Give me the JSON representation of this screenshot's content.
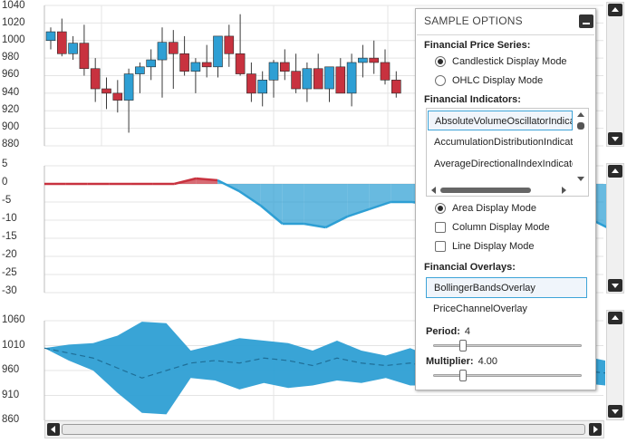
{
  "charts": {
    "price_axis": [
      "1040",
      "1020",
      "1000",
      "980",
      "960",
      "940",
      "920",
      "900",
      "880"
    ],
    "indicator_axis": [
      "5",
      "0",
      "-5",
      "-10",
      "-15",
      "-20",
      "-25",
      "-30"
    ],
    "overlay_axis": [
      "1060",
      "1010",
      "960",
      "910",
      "860"
    ]
  },
  "chart_data": [
    {
      "type": "candlestick",
      "ylim": [
        880,
        1040
      ],
      "rising_color": "#2e9fd4",
      "falling_color": "#c8323f",
      "candles": [
        {
          "o": 1000,
          "h": 1015,
          "l": 990,
          "c": 1010
        },
        {
          "o": 1010,
          "h": 1025,
          "l": 982,
          "c": 985
        },
        {
          "o": 985,
          "h": 1005,
          "l": 978,
          "c": 997
        },
        {
          "o": 997,
          "h": 1018,
          "l": 960,
          "c": 968
        },
        {
          "o": 968,
          "h": 980,
          "l": 930,
          "c": 945
        },
        {
          "o": 945,
          "h": 958,
          "l": 922,
          "c": 940
        },
        {
          "o": 940,
          "h": 955,
          "l": 918,
          "c": 932
        },
        {
          "o": 932,
          "h": 968,
          "l": 895,
          "c": 962
        },
        {
          "o": 962,
          "h": 975,
          "l": 940,
          "c": 970
        },
        {
          "o": 970,
          "h": 990,
          "l": 955,
          "c": 978
        },
        {
          "o": 978,
          "h": 1015,
          "l": 935,
          "c": 998
        },
        {
          "o": 998,
          "h": 1012,
          "l": 945,
          "c": 985
        },
        {
          "o": 985,
          "h": 1005,
          "l": 960,
          "c": 965
        },
        {
          "o": 965,
          "h": 980,
          "l": 940,
          "c": 975
        },
        {
          "o": 975,
          "h": 995,
          "l": 958,
          "c": 970
        },
        {
          "o": 970,
          "h": 985,
          "l": 958,
          "c": 1005
        },
        {
          "o": 1005,
          "h": 1018,
          "l": 970,
          "c": 985
        },
        {
          "o": 985,
          "h": 1030,
          "l": 960,
          "c": 962
        },
        {
          "o": 962,
          "h": 975,
          "l": 930,
          "c": 940
        },
        {
          "o": 940,
          "h": 965,
          "l": 925,
          "c": 955
        },
        {
          "o": 955,
          "h": 978,
          "l": 935,
          "c": 975
        },
        {
          "o": 975,
          "h": 990,
          "l": 955,
          "c": 965
        },
        {
          "o": 965,
          "h": 985,
          "l": 940,
          "c": 945
        },
        {
          "o": 945,
          "h": 975,
          "l": 930,
          "c": 968
        },
        {
          "o": 968,
          "h": 985,
          "l": 948,
          "c": 945
        },
        {
          "o": 945,
          "h": 970,
          "l": 930,
          "c": 970
        },
        {
          "o": 970,
          "h": 980,
          "l": 950,
          "c": 940
        },
        {
          "o": 940,
          "h": 985,
          "l": 925,
          "c": 975
        },
        {
          "o": 975,
          "h": 995,
          "l": 958,
          "c": 980
        },
        {
          "o": 980,
          "h": 1000,
          "l": 962,
          "c": 975
        },
        {
          "o": 975,
          "h": 990,
          "l": 950,
          "c": 955
        },
        {
          "o": 955,
          "h": 965,
          "l": 935,
          "c": 940
        }
      ]
    },
    {
      "type": "area",
      "ylim": [
        -30,
        5
      ],
      "positive_color": "#c8323f",
      "negative_color": "#2e9fd4",
      "x": [
        0,
        1,
        2,
        3,
        4,
        5,
        6,
        7,
        8,
        9,
        10,
        11,
        12,
        13,
        14,
        15,
        16,
        17,
        18,
        19,
        20,
        21,
        22,
        23,
        24,
        25,
        26
      ],
      "values": [
        0,
        0,
        0,
        0,
        0,
        0,
        0,
        1.5,
        1,
        -2,
        -6,
        -11,
        -11,
        -12,
        -9,
        -7,
        -5,
        -5,
        -6,
        -8,
        -10,
        -10,
        -6,
        -3,
        -6,
        -9,
        -12
      ]
    },
    {
      "type": "area",
      "ylim": [
        860,
        1060
      ],
      "color": "#2e9fd4",
      "x": [
        0,
        1,
        2,
        3,
        4,
        5,
        6,
        7,
        8,
        9,
        10,
        11,
        12,
        13,
        14,
        15,
        16,
        17,
        18,
        19,
        20,
        21,
        22,
        23
      ],
      "upper": [
        1005,
        1012,
        1015,
        1030,
        1058,
        1055,
        1000,
        1012,
        1025,
        1020,
        1015,
        1000,
        1020,
        1000,
        990,
        1005,
        985,
        990,
        985,
        995,
        990,
        985,
        990,
        980
      ],
      "middle": [
        1005,
        995,
        985,
        965,
        945,
        960,
        975,
        980,
        975,
        985,
        980,
        970,
        985,
        975,
        970,
        975,
        965,
        970,
        970,
        965,
        960,
        965,
        960,
        955
      ],
      "lower": [
        1005,
        980,
        960,
        915,
        875,
        872,
        945,
        940,
        922,
        935,
        925,
        930,
        940,
        935,
        945,
        930,
        930,
        935,
        940,
        935,
        925,
        930,
        935,
        930
      ]
    }
  ],
  "panel": {
    "title": "SAMPLE OPTIONS",
    "price_section": "Financial Price Series:",
    "candlestick_label": "Candlestick Display Mode",
    "ohlc_label": "OHLC Display Mode",
    "indicators_section": "Financial Indicators:",
    "indicators": [
      "AbsoluteVolumeOscillatorIndicator",
      "AccumulationDistributionIndicator",
      "AverageDirectionalIndexIndicator"
    ],
    "area_mode": "Area Display Mode",
    "column_mode": "Column Display Mode",
    "line_mode": "Line Display Mode",
    "overlays_section": "Financial Overlays:",
    "overlays": [
      "BollingerBandsOverlay",
      "PriceChannelOverlay"
    ],
    "period_label": "Period:",
    "period_value": "4",
    "period_fraction": 0.18,
    "multiplier_label": "Multiplier:",
    "multiplier_value": "4.00",
    "multiplier_fraction": 0.18
  }
}
